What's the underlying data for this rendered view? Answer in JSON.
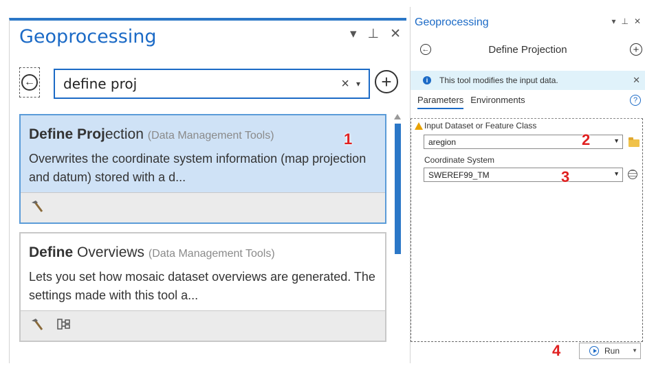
{
  "left": {
    "title": "Geoprocessing",
    "window_controls": [
      "▾",
      "⊥",
      "✕"
    ],
    "search": {
      "value": "define proj",
      "clear": "×",
      "dropdown": "▾"
    },
    "back_symbol": "←",
    "add_symbol": "+",
    "results": [
      {
        "name_bold": "Define Proj",
        "name_rest": "ection",
        "category": "(Data Management Tools)",
        "description": "Overwrites the coordinate system information (map projection and datum) stored with a d...",
        "footer_icons": [
          "hammer-icon"
        ]
      },
      {
        "name_bold": "Define",
        "name_rest": " Overviews",
        "category": "(Data Management Tools)",
        "description": "Lets you set how mosaic dataset overviews are generated. The settings made with this tool a...",
        "footer_icons": [
          "hammer-icon",
          "model-builder-icon"
        ]
      }
    ]
  },
  "right": {
    "title": "Geoprocessing",
    "window_controls": [
      "▾",
      "⊥",
      "✕"
    ],
    "tool_title": "Define Projection",
    "info_message": "This tool modifies the input data.",
    "info_close": "✕",
    "tabs": [
      "Parameters",
      "Environments"
    ],
    "help": "?",
    "params": {
      "input_label": "Input Dataset or Feature Class",
      "input_value": "aregion",
      "cs_label": "Coordinate System",
      "cs_value": "SWEREF99_TM"
    },
    "run_label": "Run"
  },
  "annotations": [
    "1",
    "2",
    "3",
    "4"
  ],
  "colors": {
    "accent": "#1b6ac6",
    "selected": "#cfe2f6",
    "annotation": "#e02020",
    "info_bg": "#e0f2fa"
  }
}
